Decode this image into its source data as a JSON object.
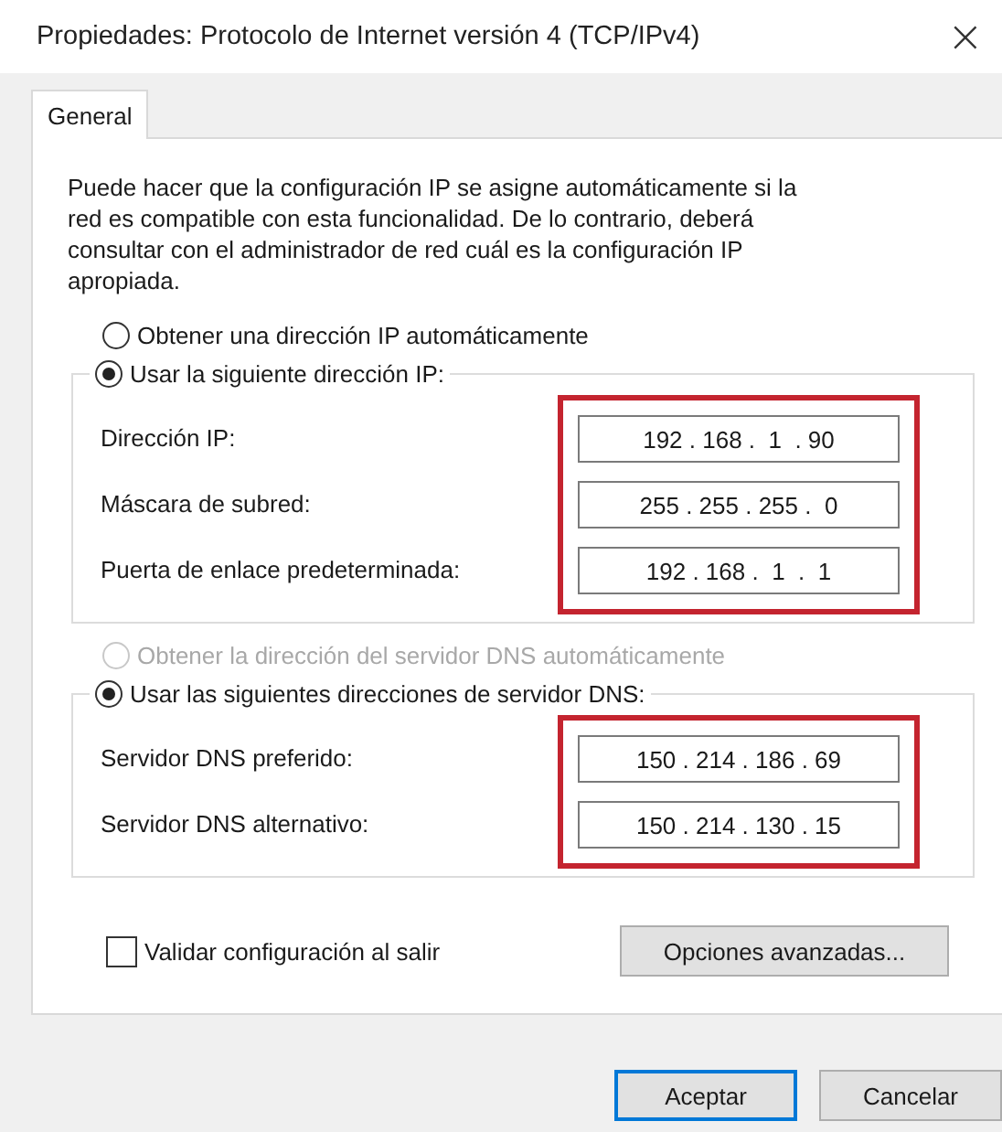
{
  "window": {
    "title": "Propiedades: Protocolo de Internet versión 4 (TCP/IPv4)",
    "close": "×"
  },
  "tabs": [
    {
      "label": "General",
      "selected": true
    }
  ],
  "intro": "Puede hacer que la configuración IP se asigne automáticamente si la red es compatible con esta funcionalidad. De lo contrario, deberá consultar con el administrador de red cuál es la configuración IP apropiada.",
  "sections": [
    {
      "auto_option": {
        "label": "Obtener una dirección IP automáticamente",
        "selected": false,
        "disabled": false
      },
      "manual_option": {
        "label": "Usar la siguiente dirección IP:",
        "selected": true,
        "disabled": false
      },
      "highlighted": true,
      "fields": [
        {
          "label": "Dirección IP:",
          "value": "192 . 168 .  1  . 90"
        },
        {
          "label": "Máscara de subred:",
          "value": "255 . 255 . 255 .  0"
        },
        {
          "label": "Puerta de enlace predeterminada:",
          "value": "192 . 168 .  1  .  1"
        }
      ]
    },
    {
      "auto_option": {
        "label": "Obtener la dirección del servidor DNS automáticamente",
        "selected": false,
        "disabled": true
      },
      "manual_option": {
        "label": "Usar las siguientes direcciones de servidor DNS:",
        "selected": true,
        "disabled": false
      },
      "highlighted": true,
      "fields": [
        {
          "label": "Servidor DNS preferido:",
          "value": "150 . 214 . 186 . 69"
        },
        {
          "label": "Servidor DNS alternativo:",
          "value": "150 . 214 . 130 . 15"
        }
      ]
    }
  ],
  "validate": {
    "label": "Validar configuración al salir",
    "checked": false
  },
  "advanced_button": "Opciones avanzadas...",
  "buttons": [
    {
      "label": "Aceptar",
      "default": true
    },
    {
      "label": "Cancelar",
      "default": false
    }
  ]
}
